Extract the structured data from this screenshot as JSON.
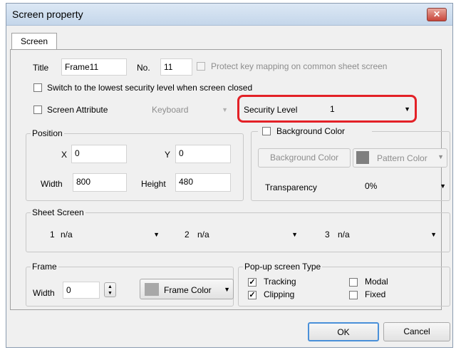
{
  "window": {
    "title": "Screen property",
    "close_glyph": "✕"
  },
  "tabs": [
    {
      "label": "Screen"
    }
  ],
  "general": {
    "title_label": "Title",
    "title_value": "Frame11",
    "no_label": "No.",
    "no_value": "11",
    "protect_label": "Protect key mapping on common sheet screen",
    "switch_label": "Switch to the lowest security level when screen closed",
    "screen_attribute_label": "Screen Attribute",
    "keyboard_value": "Keyboard",
    "security_level_label": "Security Level",
    "security_level_value": "1"
  },
  "position": {
    "title": "Position",
    "x_label": "X",
    "x_value": "0",
    "y_label": "Y",
    "y_value": "0",
    "width_label": "Width",
    "width_value": "800",
    "height_label": "Height",
    "height_value": "480"
  },
  "background": {
    "title": "Background Color",
    "bg_color_button": "Background Color",
    "pattern_color_button": "Pattern Color",
    "transparency_label": "Transparency",
    "transparency_value": "0%"
  },
  "sheet_screen": {
    "title": "Sheet Screen",
    "slots": [
      {
        "index": "1",
        "value": "n/a"
      },
      {
        "index": "2",
        "value": "n/a"
      },
      {
        "index": "3",
        "value": "n/a"
      }
    ]
  },
  "frame": {
    "title": "Frame",
    "width_label": "Width",
    "width_value": "0",
    "frame_color_button": "Frame Color"
  },
  "popup": {
    "title": "Pop-up screen Type",
    "tracking_label": "Tracking",
    "tracking_checked": true,
    "clipping_label": "Clipping",
    "clipping_checked": true,
    "modal_label": "Modal",
    "modal_checked": false,
    "fixed_label": "Fixed",
    "fixed_checked": false
  },
  "footer": {
    "ok_label": "OK",
    "cancel_label": "Cancel"
  },
  "colors": {
    "highlight": "#e32127",
    "swatch_gray": "#a8a8a8",
    "pattern_swatch": "#7f7f7f"
  }
}
